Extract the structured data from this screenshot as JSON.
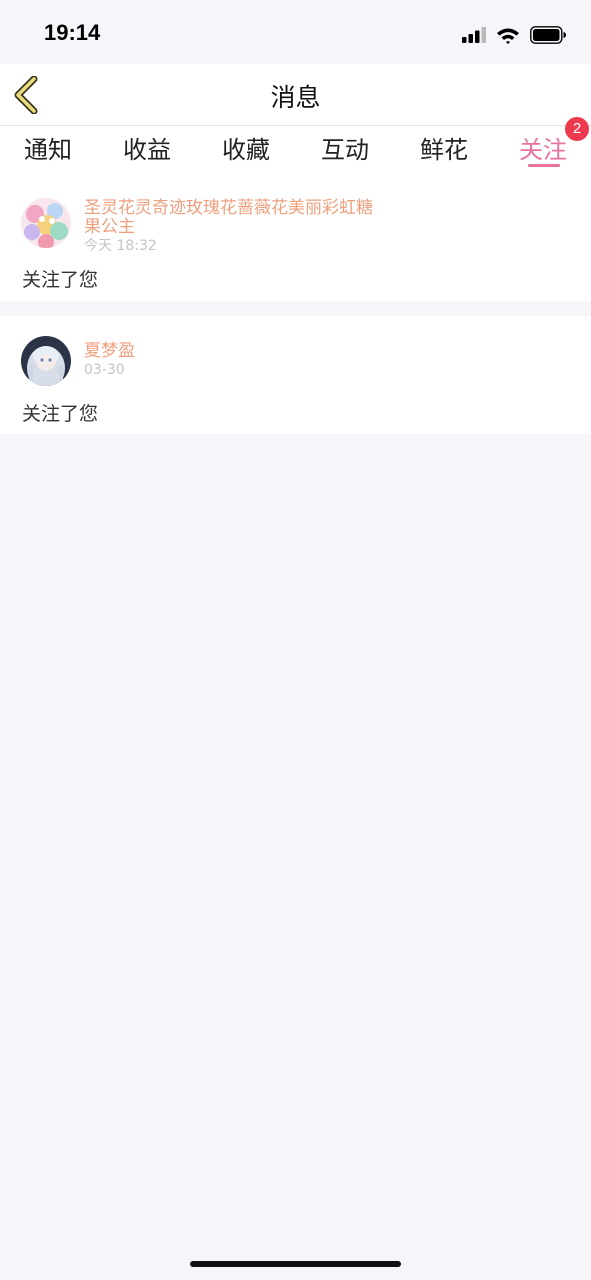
{
  "status_bar": {
    "time": "19:14"
  },
  "header": {
    "title": "消息",
    "back_icon": "chevron-left-icon",
    "accent_color": "#e8729f"
  },
  "tabs": [
    {
      "label": "通知"
    },
    {
      "label": "收益"
    },
    {
      "label": "收藏"
    },
    {
      "label": "互动"
    },
    {
      "label": "鲜花"
    },
    {
      "label": "关注",
      "active": true,
      "badge": "2"
    }
  ],
  "notifications": [
    {
      "user": "圣灵花灵奇迹玫瑰花蔷薇花美丽彩虹糖果公主",
      "time": "今天 18:32",
      "message": "关注了您"
    },
    {
      "user": "夏梦盈",
      "time": "03-30",
      "message": "关注了您"
    }
  ]
}
